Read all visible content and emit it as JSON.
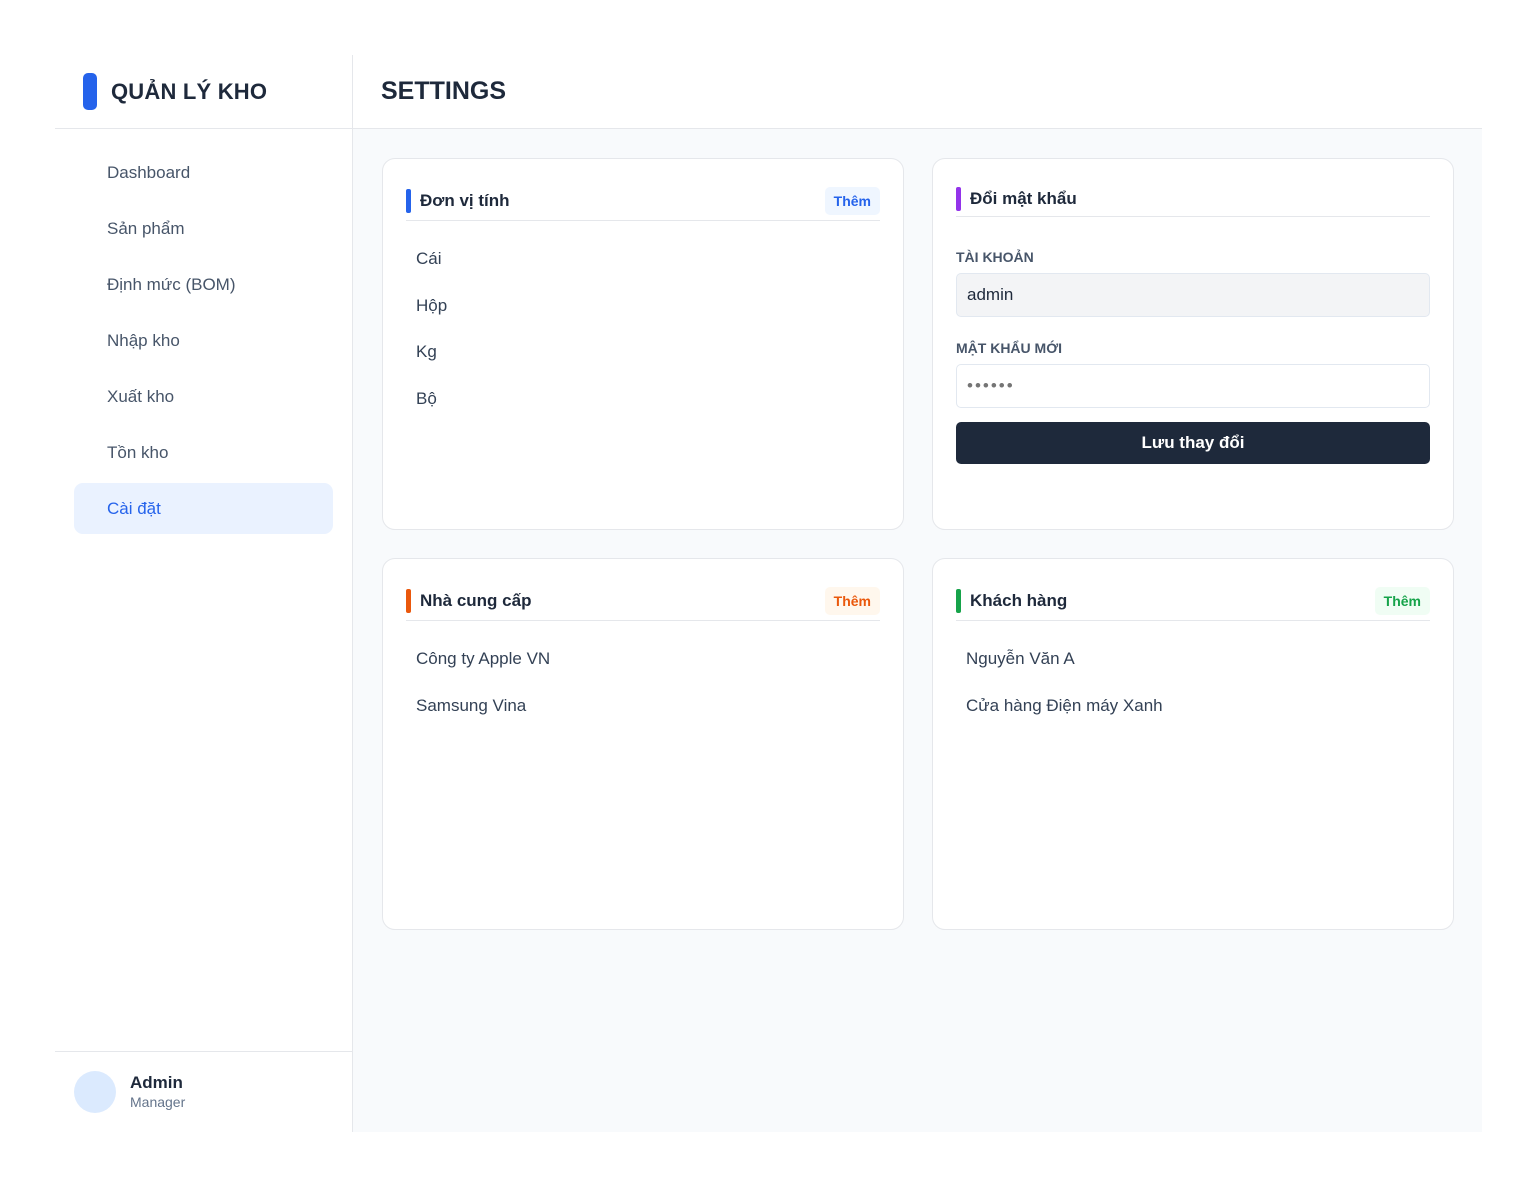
{
  "brand": {
    "title": "QUẢN LÝ KHO",
    "color": "#2563eb"
  },
  "sidebar": {
    "items": [
      {
        "label": "Dashboard",
        "active": false
      },
      {
        "label": "Sản phẩm",
        "active": false
      },
      {
        "label": "Định mức (BOM)",
        "active": false
      },
      {
        "label": "Nhập kho",
        "active": false
      },
      {
        "label": "Xuất kho",
        "active": false
      },
      {
        "label": "Tồn kho",
        "active": false
      },
      {
        "label": "Cài đặt",
        "active": true
      }
    ]
  },
  "user": {
    "name": "Admin",
    "role": "Manager"
  },
  "header": {
    "title": "SETTINGS"
  },
  "units_card": {
    "title": "Đơn vị tính",
    "add_label": "Thêm",
    "accent": "#2563eb",
    "items": [
      "Cái",
      "Hộp",
      "Kg",
      "Bộ"
    ]
  },
  "password_card": {
    "title": "Đổi mật khẩu",
    "accent": "#9333ea",
    "account_label": "TÀI KHOẢN",
    "account_value": "admin",
    "new_password_label": "MẬT KHẨU MỚI",
    "new_password_placeholder": "••••••",
    "save_label": "Lưu thay đổi"
  },
  "suppliers_card": {
    "title": "Nhà cung cấp",
    "add_label": "Thêm",
    "accent": "#ea580c",
    "items": [
      "Công ty Apple VN",
      "Samsung Vina"
    ]
  },
  "customers_card": {
    "title": "Khách hàng",
    "add_label": "Thêm",
    "accent": "#16a34a",
    "items": [
      "Nguyễn Văn A",
      "Cửa hàng Điện máy Xanh"
    ]
  }
}
